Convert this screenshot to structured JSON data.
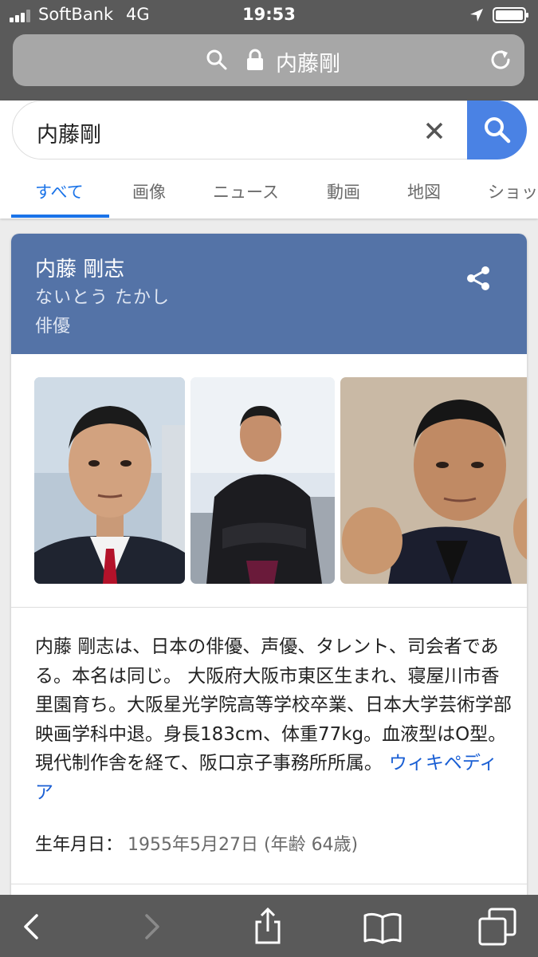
{
  "status_bar": {
    "carrier": "SoftBank",
    "network": "4G",
    "time": "19:53"
  },
  "browser": {
    "url_text": "内藤剛",
    "toolbar_buttons": [
      "back",
      "forward",
      "share",
      "bookmarks",
      "tabs"
    ]
  },
  "search": {
    "query": "内藤剛",
    "tabs": [
      {
        "label": "すべて",
        "active": true
      },
      {
        "label": "画像",
        "active": false
      },
      {
        "label": "ニュース",
        "active": false
      },
      {
        "label": "動画",
        "active": false
      },
      {
        "label": "地図",
        "active": false
      },
      {
        "label": "ショッ",
        "active": false
      }
    ]
  },
  "knowledge_panel": {
    "name": "内藤 剛志",
    "reading": "ないとう たかし",
    "type": "俳優",
    "description": "内藤 剛志は、日本の俳優、声優、タレント、司会者である。本名は同じ。 大阪府大阪市東区生まれ、寝屋川市香里園育ち。大阪星光学院高等学校卒業、日本大学芸術学部映画学科中退。身長183cm、体重77kg。血液型はO型。現代制作舎を経て、阪口京子事務所所属。",
    "source_link": "ウィキペディア",
    "birth_label": "生年月日：",
    "birth_value": "1955年5月27日 (年齢 64歳)"
  },
  "colors": {
    "accent_blue": "#1a73e8",
    "panel_header": "#5473a7",
    "search_button": "#4a82e4",
    "browser_chrome": "#5a5a5a"
  }
}
